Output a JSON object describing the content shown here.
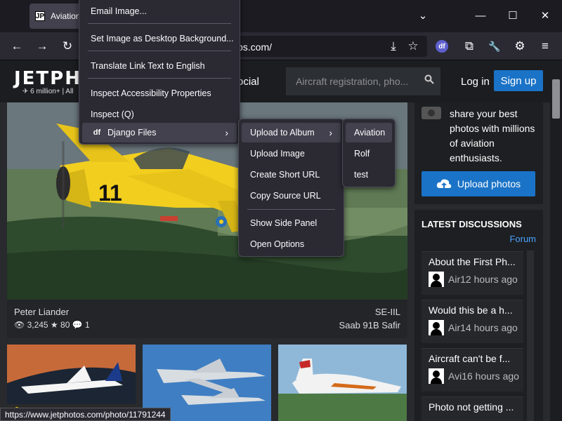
{
  "browser": {
    "tab_title": "Aviation",
    "tab_favicon": "JP",
    "url_text": "ps.com/",
    "minimize": "—",
    "maximize": "☐",
    "close": "✕",
    "chevron": "⌄",
    "back": "←",
    "forward": "→",
    "reload": "↻",
    "save_icon": "⤓",
    "star_icon": "☆",
    "df_icon": "df",
    "puzzle_icon": "⧉",
    "wrench_icon": "🔧",
    "gear_icon": "⚙",
    "menu_icon": "≡",
    "status_url": "https://www.jetphotos.com/photo/11791244"
  },
  "site": {
    "logo": "JETPHO",
    "logo_sub": "✈ 6 million+ | All",
    "nav_social": "ocial",
    "search_placeholder": "Aircraft registration, pho...",
    "login": "Log in",
    "signup": "Sign up"
  },
  "hero": {
    "photographer": "Peter Liander",
    "stats": "👁 3,245  ★ 80  💬 1",
    "registration": "SE-IIL",
    "aircraft": "Saab 91B Safir",
    "fin_number": "11"
  },
  "sidebar": {
    "share_text": "share your best photos with millions of aviation enthusiasts.",
    "upload_label": "Upload photos",
    "discussions_title": "LATEST DISCUSSIONS",
    "forum_link": "Forum",
    "discussions": [
      {
        "title": "About the First Ph...",
        "meta": "Air12 hours ago"
      },
      {
        "title": "Would this be a h...",
        "meta": "Air14 hours ago"
      },
      {
        "title": "Aircraft can't be f...",
        "meta": "Avi16 hours ago"
      },
      {
        "title": "Photo not getting ...",
        "meta": ""
      }
    ]
  },
  "context_menu": {
    "items": [
      {
        "label": "Email Image..."
      },
      {
        "label": "Set Image as Desktop Background..."
      },
      {
        "label": "Translate Link Text to English"
      },
      {
        "label": "Inspect Accessibility Properties"
      },
      {
        "label": "Inspect (Q)"
      },
      {
        "label": "Django Files",
        "icon": "df"
      }
    ]
  },
  "submenu": {
    "items": [
      {
        "label": "Upload to Album"
      },
      {
        "label": "Upload Image"
      },
      {
        "label": "Create Short URL"
      },
      {
        "label": "Copy Source URL"
      },
      {
        "label": "Show Side Panel"
      },
      {
        "label": "Open Options"
      }
    ]
  },
  "album_menu": {
    "items": [
      {
        "label": "Aviation"
      },
      {
        "label": "Rolf"
      },
      {
        "label": "test"
      }
    ]
  },
  "arrow": "›",
  "colors": {
    "accent": "#1a73c7",
    "menu_bg": "#2b2a33",
    "aircraft_yellow": "#f2cf1f"
  }
}
